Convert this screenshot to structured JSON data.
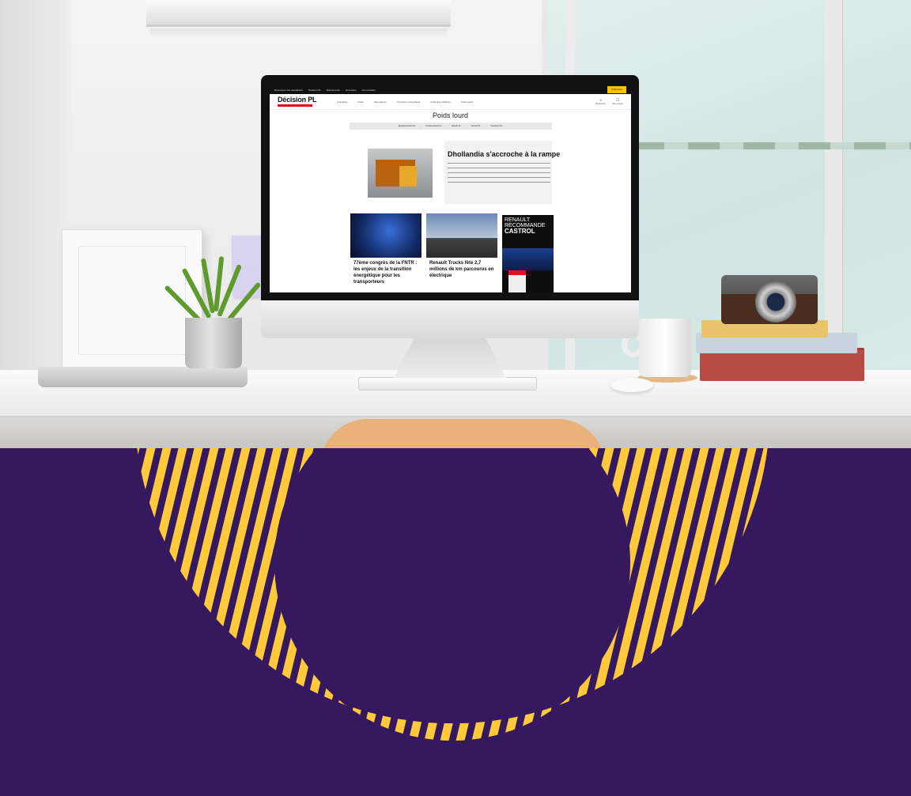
{
  "colors": {
    "brand_red": "#e30613",
    "subscribe_yellow": "#f5c400",
    "band_purple": "#36185f",
    "ring_yellow": "#ffc93c"
  },
  "screen": {
    "utility_bar": {
      "items": [
        "Découvrez nos newsletters",
        "Décision PL",
        "Événements",
        "Hors-série",
        "Vos contacts"
      ],
      "subscribe_label": "S'abonner"
    },
    "nav": {
      "logo": "Décision PL",
      "links": [
        "Actualités",
        "Flotte",
        "Alternatives",
        "Transition énergétique",
        "Véhicules utilitaires",
        "Poids lourd"
      ],
      "icons": [
        {
          "icon": "search-icon",
          "label": "Rechercher"
        },
        {
          "icon": "user-icon",
          "label": "Mon compte"
        }
      ]
    },
    "page_title": "Poids lourd",
    "tabs": [
      "Équipementiers PL",
      "Constructeurs PL",
      "Essais PL",
      "Ventes PL",
      "Transport PL"
    ],
    "feature": {
      "title": "Dhollandia s'accroche à la rampe"
    },
    "cards": [
      {
        "title": "77ème congrès de la FNTR : les enjeux de la transition énergétique pour les transporteurs"
      },
      {
        "title": "Renault Trucks fête 2,7 millions de km parcourus en électrique"
      }
    ],
    "ad": {
      "line1": "RENAULT",
      "line2": "RECOMMANDE",
      "line3": "CASTROL"
    }
  }
}
